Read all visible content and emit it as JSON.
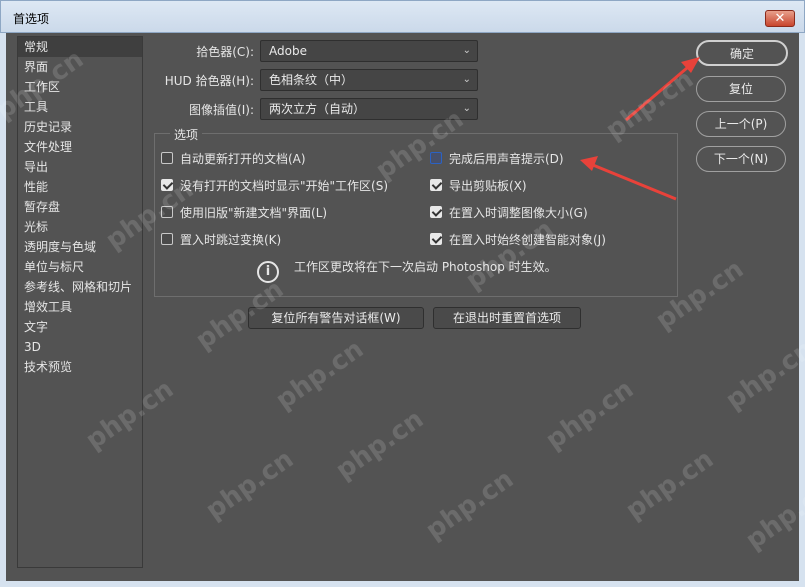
{
  "window": {
    "title": "首选项",
    "close_label": "✕"
  },
  "sidebar": {
    "items": [
      {
        "label": "常规",
        "selected": true
      },
      {
        "label": "界面"
      },
      {
        "label": "工作区"
      },
      {
        "label": "工具"
      },
      {
        "label": "历史记录"
      },
      {
        "label": "文件处理"
      },
      {
        "label": "导出"
      },
      {
        "label": "性能"
      },
      {
        "label": "暂存盘"
      },
      {
        "label": "光标"
      },
      {
        "label": "透明度与色域"
      },
      {
        "label": "单位与标尺"
      },
      {
        "label": "参考线、网格和切片"
      },
      {
        "label": "增效工具"
      },
      {
        "label": "文字"
      },
      {
        "label": "3D"
      },
      {
        "label": "技术预览"
      }
    ]
  },
  "settings": {
    "color_picker": {
      "label": "拾色器(C):",
      "value": "Adobe"
    },
    "hud_color_picker": {
      "label": "HUD 拾色器(H):",
      "value": "色相条纹（中）"
    },
    "image_interpolation": {
      "label": "图像插值(I):",
      "value": "两次立方（自动）"
    }
  },
  "options": {
    "title": "选项",
    "left": [
      {
        "label": "自动更新打开的文档(A)",
        "checked": false
      },
      {
        "label": "没有打开的文档时显示\"开始\"工作区(S)",
        "checked": true
      },
      {
        "label": "使用旧版\"新建文档\"界面(L)",
        "checked": false
      },
      {
        "label": "置入时跳过变换(K)",
        "checked": false
      }
    ],
    "right": [
      {
        "label": "完成后用声音提示(D)",
        "checked": false,
        "focused": true
      },
      {
        "label": "导出剪贴板(X)",
        "checked": true
      },
      {
        "label": "在置入时调整图像大小(G)",
        "checked": true
      },
      {
        "label": "在置入时始终创建智能对象(J)",
        "checked": true
      }
    ],
    "info_icon": "i",
    "info_text": "工作区更改将在下一次启动 Photoshop 时生效。"
  },
  "buttons": {
    "reset_warnings": "复位所有警告对话框(W)",
    "reset_on_quit": "在退出时重置首选项",
    "ok": "确定",
    "reset": "复位",
    "prev": "上一个(P)",
    "next": "下一个(N)"
  },
  "watermark_text": "php.cn",
  "colors": {
    "annotation_arrow": "#e8423a",
    "panel_bg": "#535353"
  }
}
